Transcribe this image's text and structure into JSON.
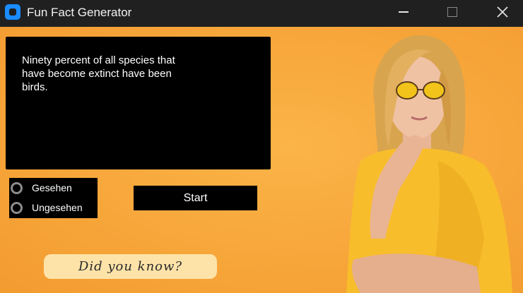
{
  "window": {
    "title": "Fun Fact Generator",
    "icon": "app-icon",
    "controls": [
      "minimize-icon",
      "maximize-icon",
      "close-icon"
    ]
  },
  "fact": {
    "text": "Ninety percent of all species that\n have become extinct have been\nbirds."
  },
  "filter": {
    "options": [
      {
        "label": "Gesehen",
        "selected": false
      },
      {
        "label": "Ungesehen",
        "selected": false
      }
    ]
  },
  "start_button": {
    "label": "Start"
  },
  "badge": {
    "text": "Did you know?"
  },
  "colors": {
    "background": "#f7a63a",
    "panel": "#000000",
    "badge": "#fde3a8",
    "accent": "#1a8cff"
  }
}
